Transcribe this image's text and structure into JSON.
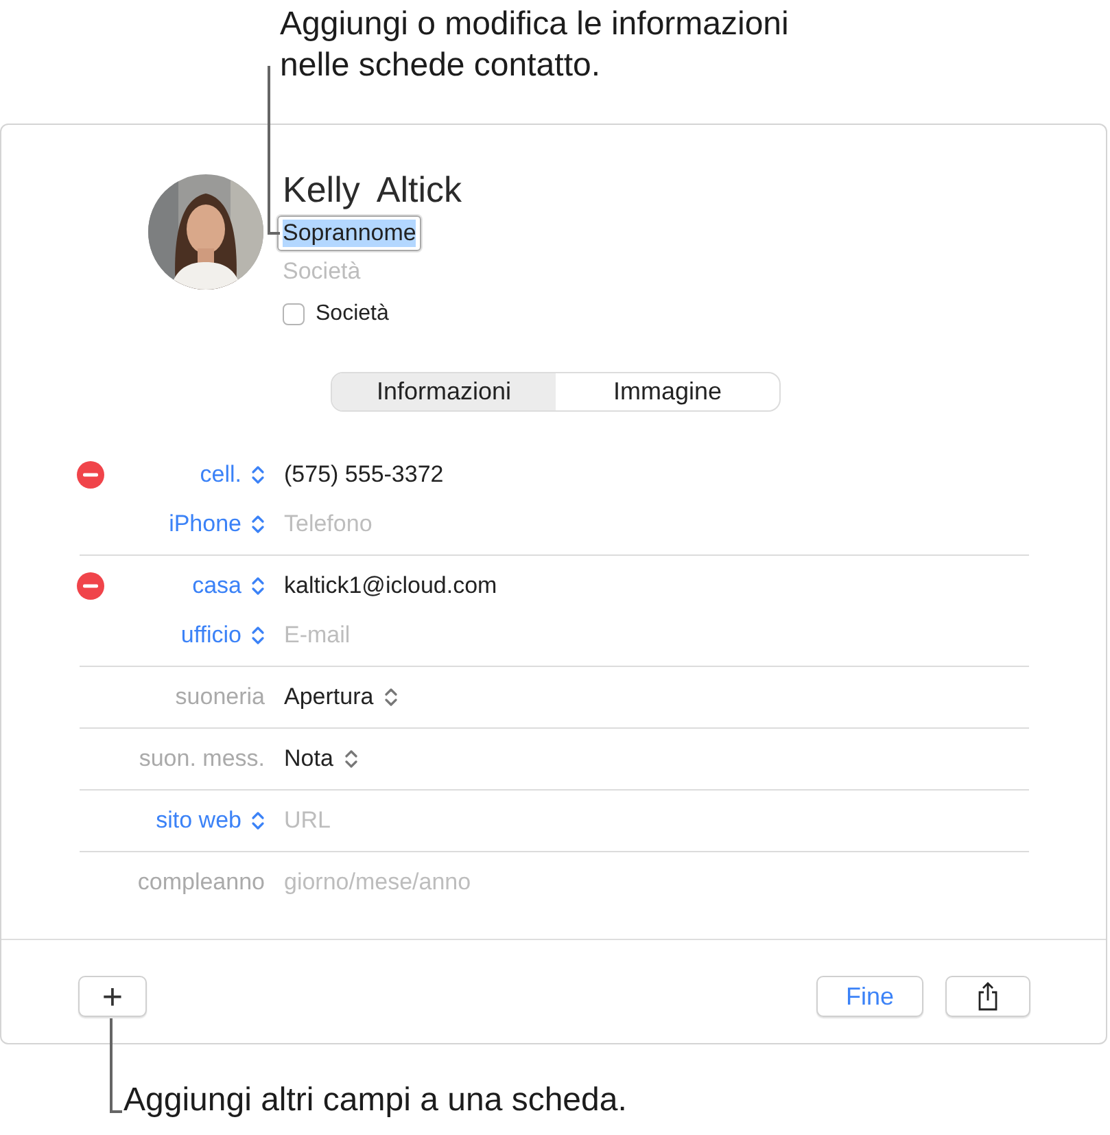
{
  "top_callout": {
    "text": "Aggiungi o modifica le informazioni\nnelle schede contatto."
  },
  "contact": {
    "first_name": "Kelly",
    "last_name": "Altick",
    "nickname": "Soprannome",
    "nickname_selected": true,
    "company_placeholder": "Società",
    "company_checkbox": {
      "label": "Società",
      "checked": false
    }
  },
  "tabs": [
    {
      "label": "Informazioni",
      "selected": true
    },
    {
      "label": "Immagine",
      "selected": false
    }
  ],
  "field_groups": [
    {
      "rows": [
        {
          "label": "cell.",
          "kind": "menu",
          "removable": true,
          "value": "(575) 555-3372"
        },
        {
          "label": "iPhone",
          "kind": "menu",
          "removable": false,
          "placeholder": "Telefono"
        }
      ]
    },
    {
      "rows": [
        {
          "label": "casa",
          "kind": "menu",
          "removable": true,
          "value": "kaltick1@icloud.com"
        },
        {
          "label": "ufficio",
          "kind": "menu",
          "removable": false,
          "placeholder": "E-mail"
        }
      ]
    },
    {
      "rows": [
        {
          "label": "suoneria",
          "kind": "static",
          "removable": false,
          "value": "Apertura",
          "value_menu": true
        }
      ]
    },
    {
      "rows": [
        {
          "label": "suon. mess.",
          "kind": "static",
          "removable": false,
          "value": "Nota",
          "value_menu": true
        }
      ]
    },
    {
      "rows": [
        {
          "label": "sito web",
          "kind": "menu",
          "removable": false,
          "placeholder": "URL"
        }
      ]
    },
    {
      "rows": [
        {
          "label": "compleanno",
          "kind": "static",
          "removable": false,
          "placeholder": "giorno/mese/anno"
        }
      ]
    }
  ],
  "footer": {
    "buttons": [
      {
        "kind": "add",
        "label": "+"
      },
      {
        "kind": "primary",
        "label": "Fine"
      },
      {
        "kind": "share"
      }
    ]
  },
  "bottom_callout": {
    "text": "Aggiungi altri campi a una scheda."
  }
}
